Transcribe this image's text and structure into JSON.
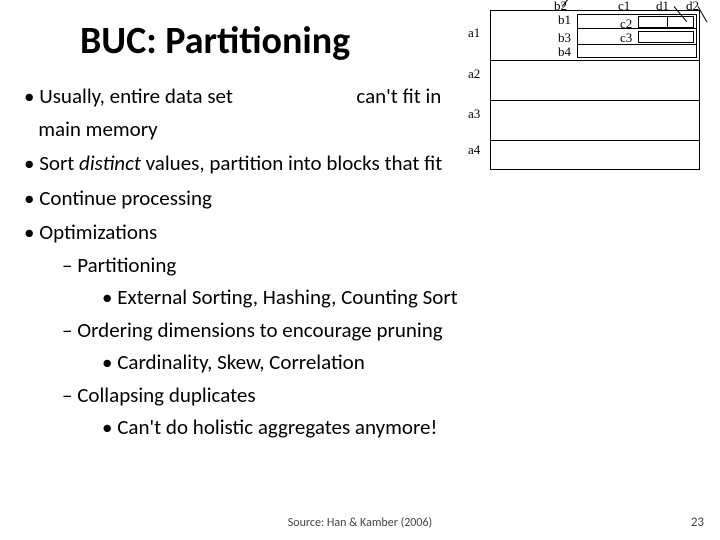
{
  "title": "BUC: Partitioning",
  "bullets": {
    "b1_line1": "Usually, entire data set                          can't fit in",
    "b1_line2": "main memory",
    "b2_pre": "Sort ",
    "b2_em": "distinct",
    "b2_post": " values, partition into blocks that fit",
    "b3": "Continue processing",
    "b4": "Optimizations",
    "b4a": "Partitioning",
    "b4a1": "External Sorting, Hashing, Counting Sort",
    "b4b": "Ordering dimensions to encourage pruning",
    "b4b1": "Cardinality, Skew, Correlation",
    "b4c": "Collapsing duplicates",
    "b4c1": "Can't do holistic aggregates anymore!"
  },
  "diagram": {
    "a1": "a1",
    "a2": "a2",
    "a3": "a3",
    "a4": "a4",
    "b1": "b1",
    "b2": "b2",
    "b3": "b3",
    "b4": "b4",
    "c1": "c1",
    "c2": "c2",
    "c3": "c3",
    "d1": "d1",
    "d2": "d2"
  },
  "source": "Source: Han & Kamber (2006)",
  "page_number": "23"
}
